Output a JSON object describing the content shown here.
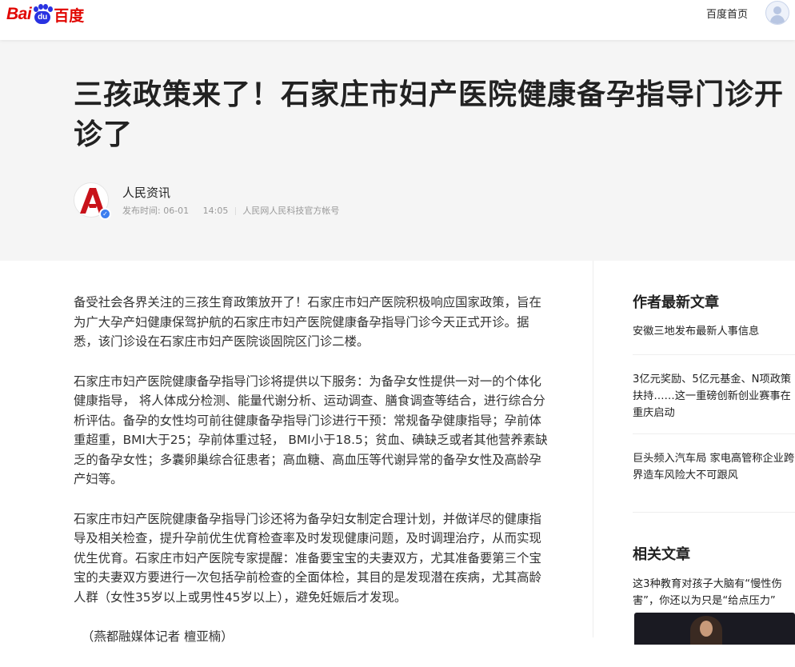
{
  "topbar": {
    "logo": {
      "bai": "Bai",
      "du": "du",
      "cn": "百度"
    },
    "home_link": "百度首页"
  },
  "header": {
    "title": "三孩政策来了！石家庄市妇产医院健康备孕指导门诊开诊了",
    "author": "人民资讯",
    "publish_label": "发布时间:",
    "publish_date": "06-01",
    "publish_time": "14:05",
    "source": "人民网人民科技官方帐号"
  },
  "article": {
    "paragraphs": [
      "备受社会各界关注的三孩生育政策放开了！石家庄市妇产医院积极响应国家政策，旨在为广大孕产妇健康保驾护航的石家庄市妇产医院健康备孕指导门诊今天正式开诊。据悉，该门诊设在石家庄市妇产医院谈固院区门诊二楼。",
      "石家庄市妇产医院健康备孕指导门诊将提供以下服务：为备孕女性提供一对一的个体化健康指导， 将人体成分检测、能量代谢分析、运动调查、膳食调查等结合，进行综合分析评估。备孕的女性均可前往健康备孕指导门诊进行干预：常规备孕健康指导；孕前体重超重，BMI大于25；孕前体重过轻， BMI小于18.5；贫血、碘缺乏或者其他营养素缺乏的备孕女性；多囊卵巢综合征患者；高血糖、高血压等代谢异常的备孕女性及高龄孕产妇等。",
      "石家庄市妇产医院健康备孕指导门诊还将为备孕妇女制定合理计划，并做详尽的健康指导及相关检查，提升孕前优生优育检查率及时发现健康问题，及时调理治疗，从而实现优生优育。石家庄市妇产医院专家提醒：准备要宝宝的夫妻双方，尤其准备要第三个宝宝的夫妻双方要进行一次包括孕前检查的全面体检，其目的是发现潜在疾病，尤其高龄人群（女性35岁以上或男性45岁以上），避免妊娠后才发现。"
    ],
    "credit": "（燕都融媒体记者 檀亚楠）"
  },
  "sidebar": {
    "latest_title": "作者最新文章",
    "latest": [
      "安徽三地发布最新人事信息",
      "3亿元奖励、5亿元基金、N项政策扶持……这一重磅创新创业赛事在重庆启动",
      "巨头频入汽车局 家电高管称企业跨界造车风险大不可跟风"
    ],
    "related_title": "相关文章",
    "related": [
      "这3种教育对孩子大脑有“慢性伤害”，你还以为只是“给点压力”"
    ]
  }
}
